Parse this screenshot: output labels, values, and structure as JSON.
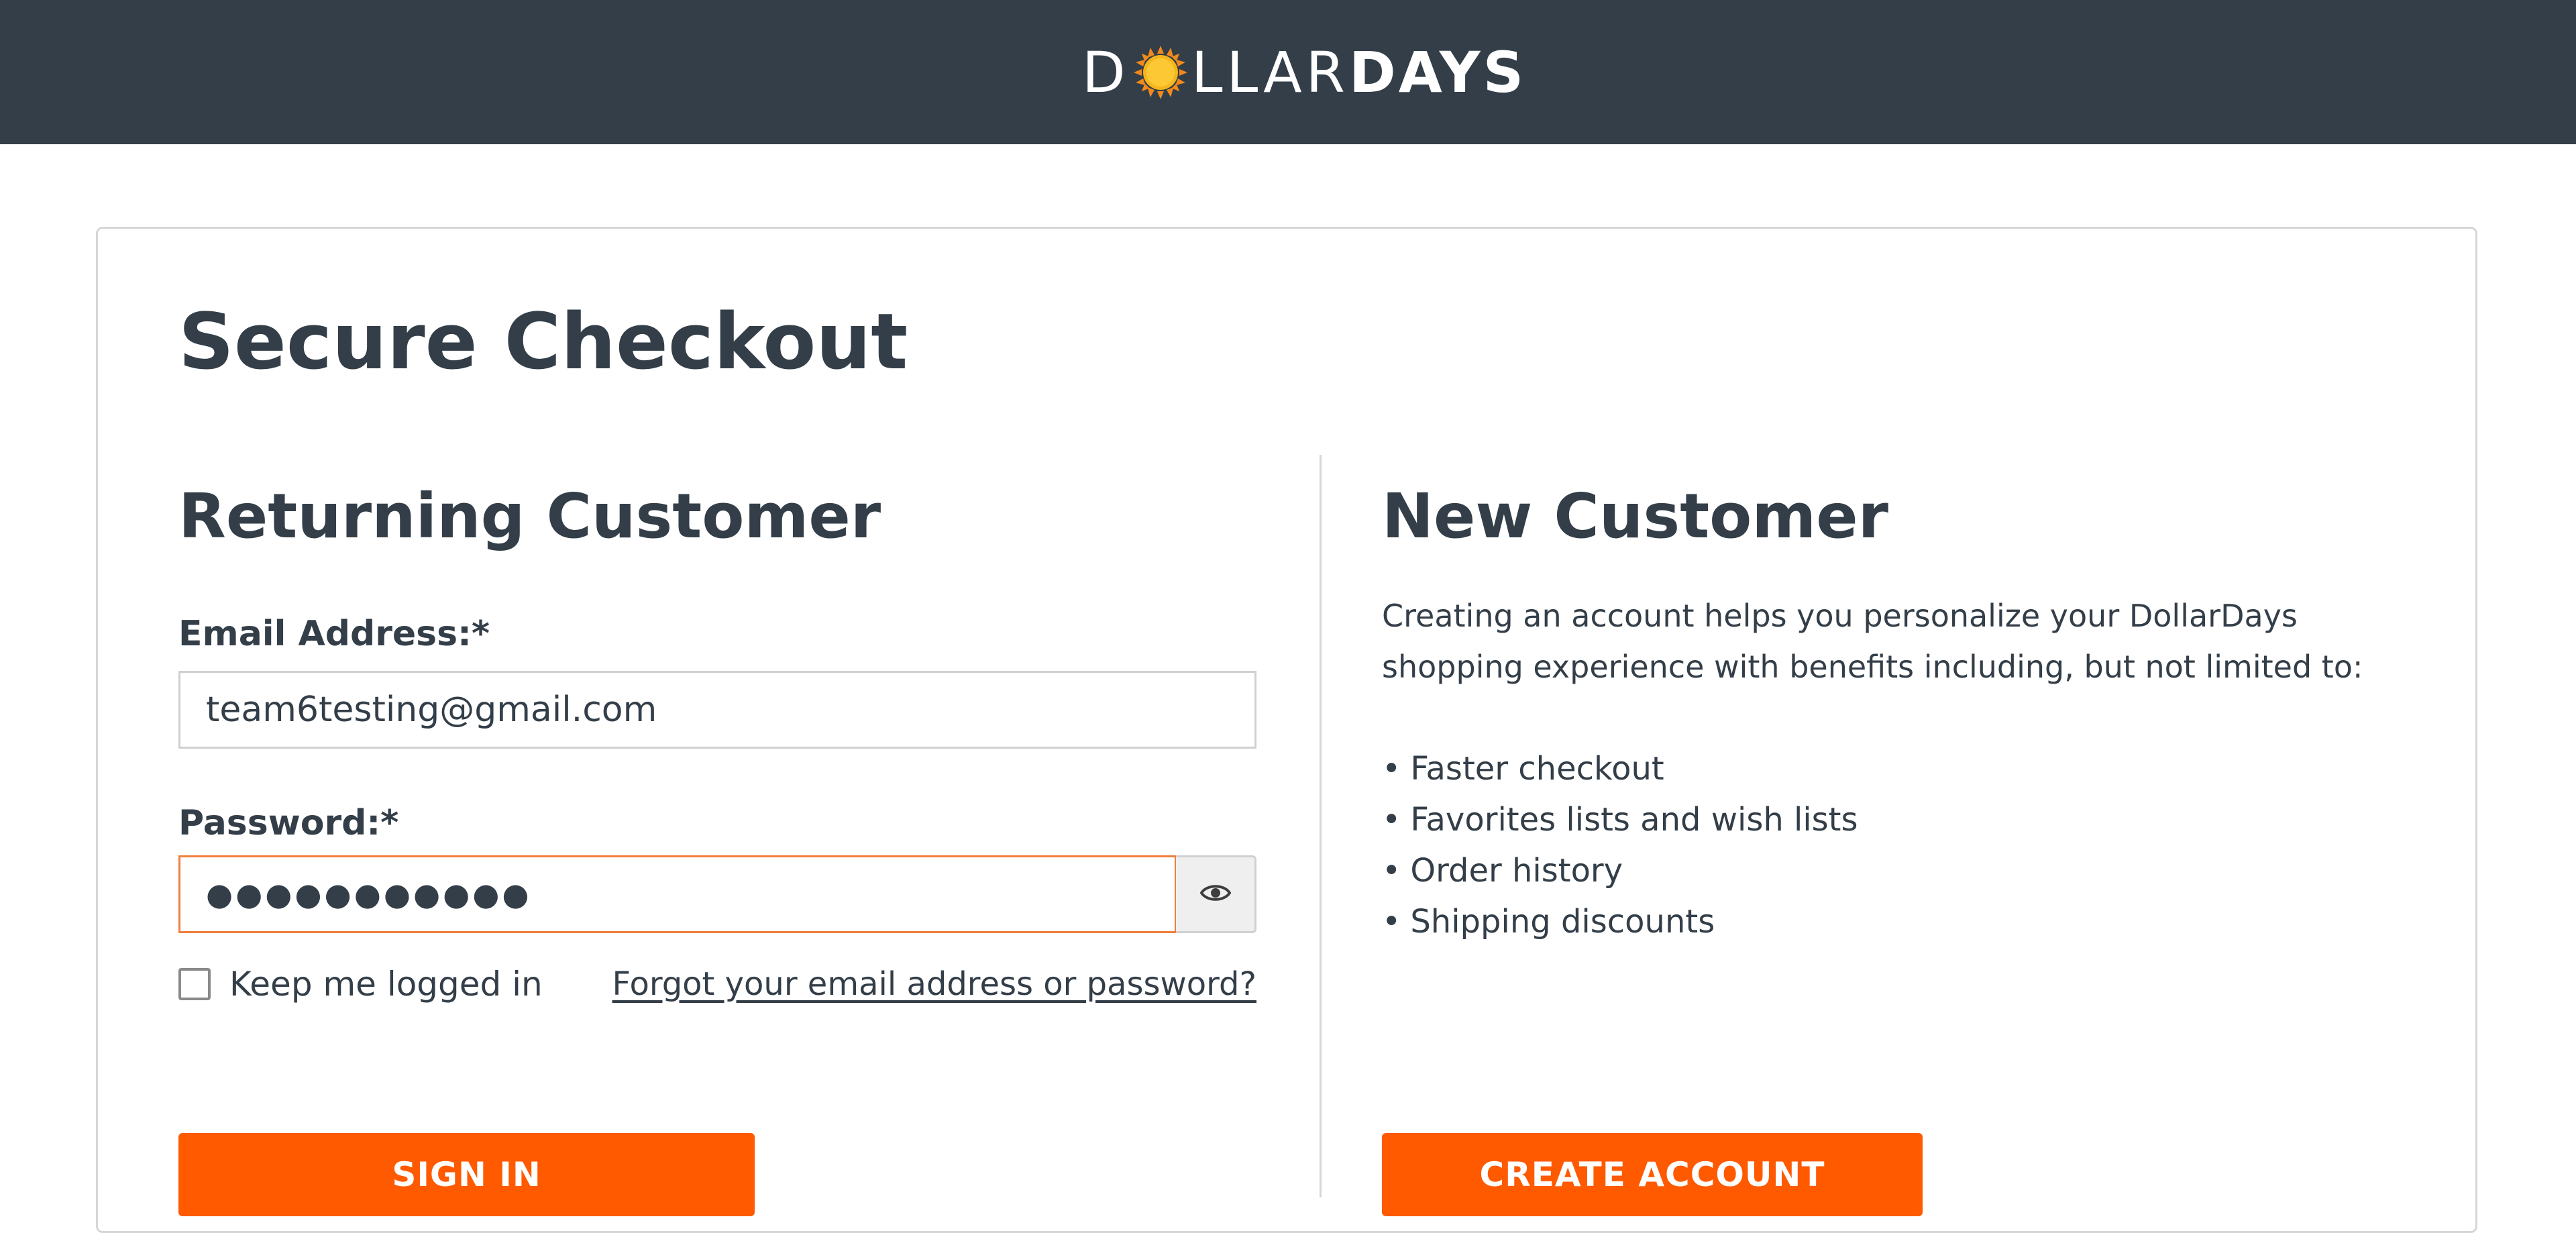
{
  "header": {
    "logo_text_light": "D",
    "logo_text_light_2": "LLAR",
    "logo_text_bold": "DAYS",
    "logo_icon": "sun-icon",
    "background_color": "#333e48"
  },
  "page": {
    "title": "Secure Checkout"
  },
  "returning_customer": {
    "title": "Returning Customer",
    "email_label": "Email Address:*",
    "email_value": "team6testing@gmail.com",
    "password_label": "Password:*",
    "password_value": "●●●●●●●●●●●",
    "show_password_icon": "eye-icon",
    "keep_logged_in_label": "Keep me logged in",
    "keep_logged_in_checked": false,
    "forgot_link": "Forgot your email address or password?",
    "sign_in_button": "SIGN IN"
  },
  "new_customer": {
    "title": "New Customer",
    "description": "Creating an account helps you personalize your DollarDays shopping experience with benefits including, but not limited to:",
    "benefits": [
      "Faster checkout",
      "Favorites lists and wish lists",
      "Order history",
      "Shipping discounts"
    ],
    "create_account_button": "CREATE ACCOUNT"
  },
  "colors": {
    "accent": "#ff5a00",
    "text": "#333e48",
    "focus_border": "#f07f3c"
  }
}
